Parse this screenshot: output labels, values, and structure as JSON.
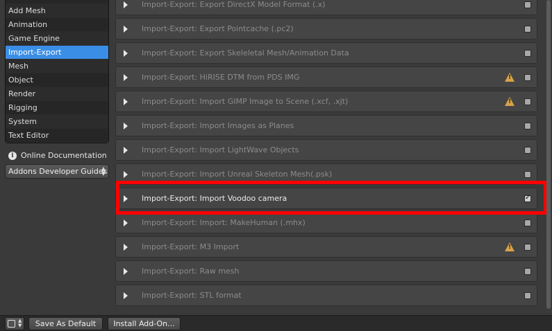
{
  "sidebar": {
    "categories": [
      {
        "label": ""
      },
      {
        "label": "Add Mesh"
      },
      {
        "label": "Animation"
      },
      {
        "label": "Game Engine"
      },
      {
        "label": "Import-Export",
        "selected": true
      },
      {
        "label": "Mesh"
      },
      {
        "label": "Object"
      },
      {
        "label": "Render"
      },
      {
        "label": "Rigging"
      },
      {
        "label": "System"
      },
      {
        "label": "Text Editor"
      }
    ],
    "online_docs_label": "Online Documentation",
    "online_docs_icon": "info-icon",
    "guides_select_value": "Addons Developer Guides"
  },
  "addons": [
    {
      "label": "Import-Export: Export DirectX Model Format (.x)",
      "enabled": false,
      "warning": false
    },
    {
      "label": "Import-Export: Export Pointcache (.pc2)",
      "enabled": false,
      "warning": false
    },
    {
      "label": "Import-Export: Export Skeleletal Mesh/Animation Data",
      "enabled": false,
      "warning": false
    },
    {
      "label": "Import-Export: HiRISE DTM from PDS IMG",
      "enabled": false,
      "warning": true
    },
    {
      "label": "Import-Export: Import GIMP Image to Scene (.xcf, .xjt)",
      "enabled": false,
      "warning": true
    },
    {
      "label": "Import-Export: Import Images as Planes",
      "enabled": false,
      "warning": false
    },
    {
      "label": "Import-Export: Import LightWave Objects",
      "enabled": false,
      "warning": false
    },
    {
      "label": "Import-Export: Import Unreal Skeleton Mesh(.psk)",
      "enabled": false,
      "warning": false
    },
    {
      "label": "Import-Export: Import Voodoo camera",
      "enabled": true,
      "warning": false,
      "highlighted": true
    },
    {
      "label": "Import-Export: Import: MakeHuman (.mhx)",
      "enabled": false,
      "warning": false
    },
    {
      "label": "Import-Export: M3 Import",
      "enabled": false,
      "warning": true
    },
    {
      "label": "Import-Export: Raw mesh",
      "enabled": false,
      "warning": false
    },
    {
      "label": "Import-Export: STL format",
      "enabled": false,
      "warning": false
    }
  ],
  "bottom_bar": {
    "save_default_label": "Save As Default",
    "install_addon_label": "Install Add-On..."
  },
  "colors": {
    "selected_category": "#3b8ee6",
    "highlight_annotation": "#ff0000",
    "warning_icon": "#d8a24a"
  }
}
